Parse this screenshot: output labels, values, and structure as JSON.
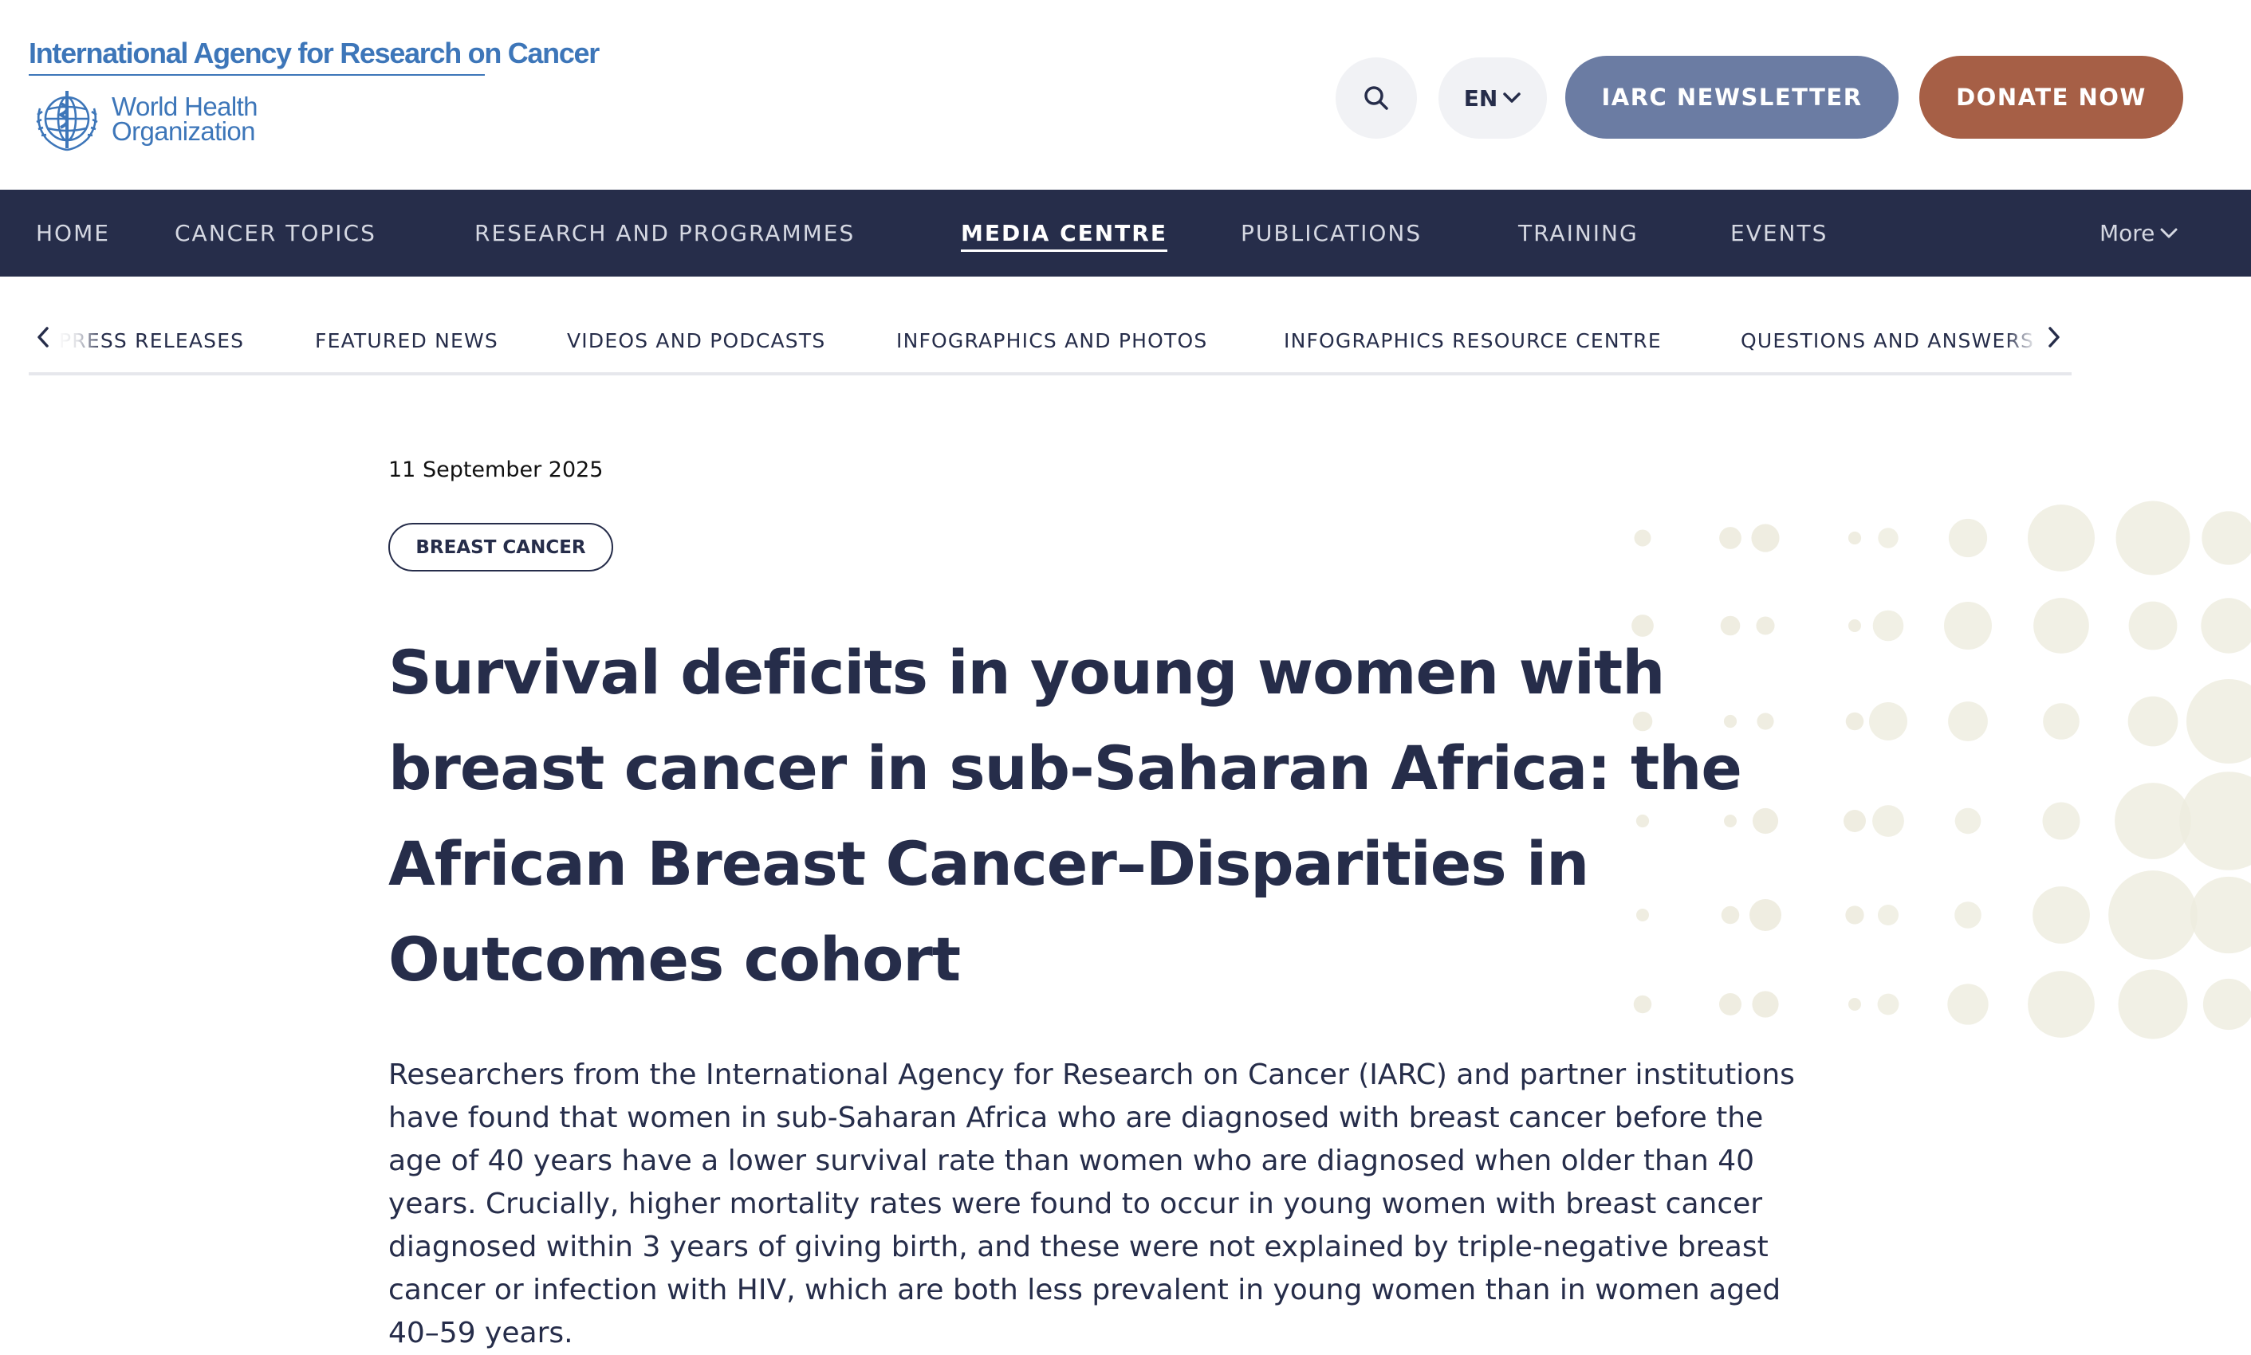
{
  "header": {
    "org_name": "International Agency for Research on Cancer",
    "who_line1": "World Health",
    "who_line2": "Organization",
    "search_icon": "search-icon",
    "language": "EN",
    "newsletter_label": "IARC NEWSLETTER",
    "donate_label": "DONATE NOW"
  },
  "colors": {
    "navy": "#262d4a",
    "newsletter": "#6b7ca3",
    "donate": "#a65f46",
    "logo_blue": "#3d76b9",
    "dots": "#eeecdf"
  },
  "main_nav": {
    "items": [
      {
        "label": "HOME"
      },
      {
        "label": "CANCER TOPICS"
      },
      {
        "label": "RESEARCH AND PROGRAMMES"
      },
      {
        "label": "MEDIA CENTRE",
        "active": true
      },
      {
        "label": "PUBLICATIONS"
      },
      {
        "label": "TRAINING"
      },
      {
        "label": "EVENTS"
      }
    ],
    "more_label": "More"
  },
  "sub_nav": {
    "items": [
      {
        "label": "PRESS RELEASES"
      },
      {
        "label": "FEATURED NEWS"
      },
      {
        "label": "VIDEOS AND PODCASTS"
      },
      {
        "label": "INFOGRAPHICS AND PHOTOS"
      },
      {
        "label": "INFOGRAPHICS RESOURCE CENTRE"
      },
      {
        "label": "QUESTIONS AND ANSWERS"
      }
    ]
  },
  "article": {
    "date": "11 September 2025",
    "tag": "BREAST CANCER",
    "title": "Survival deficits in young women with breast cancer in sub-Saharan Africa: the African Breast Cancer–Disparities in Outcomes cohort",
    "lead": "Researchers from the International Agency for Research on Cancer (IARC) and partner institutions have found that women in sub-Saharan Africa who are diagnosed with breast cancer before the age of 40 years have a lower survival rate than women who are diagnosed when older than 40 years. Crucially, higher mortality rates were found to occur in young women with breast cancer diagnosed within 3 years of giving birth, and these were not explained by triple-negative breast cancer or infection with HIV, which are both less prevalent in young women than in women aged 40–59 years."
  }
}
